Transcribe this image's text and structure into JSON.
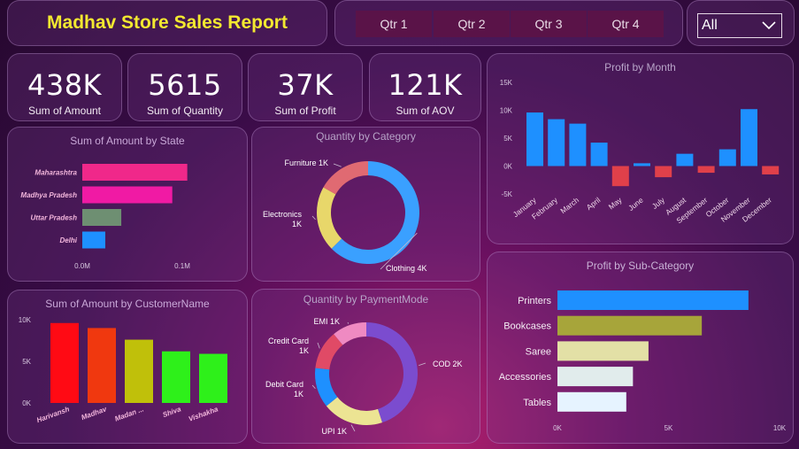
{
  "header": {
    "title": "Madhav Store Sales Report"
  },
  "quarters": [
    "Qtr 1",
    "Qtr 2",
    "Qtr 3",
    "Qtr 4"
  ],
  "filter": {
    "selected": "All"
  },
  "kpis": [
    {
      "value": "438K",
      "label": "Sum of Amount"
    },
    {
      "value": "5615",
      "label": "Sum of Quantity"
    },
    {
      "value": "37K",
      "label": "Sum of Profit"
    },
    {
      "value": "121K",
      "label": "Sum of AOV"
    }
  ],
  "colors": {
    "title": "#f2e830",
    "accent_blue": "#1e90ff",
    "negative": "#e0404a"
  },
  "chart_data": [
    {
      "id": "amount_by_state",
      "type": "bar",
      "orientation": "horizontal",
      "title": "Sum of Amount by State",
      "categories": [
        "Maharashtra",
        "Madhya Pradesh",
        "Uttar Pradesh",
        "Delhi"
      ],
      "values": [
        0.105,
        0.09,
        0.039,
        0.023
      ],
      "colors": [
        "#f0288a",
        "#f01aa4",
        "#6e8f72",
        "#1e90ff"
      ],
      "xticks": [
        "0.0M",
        "0.1M"
      ],
      "xlim": [
        0,
        0.1
      ]
    },
    {
      "id": "quantity_by_category",
      "type": "pie",
      "donut": true,
      "title": "Quantity by Category",
      "slices": [
        {
          "label": "Clothing 4K",
          "value": 3516,
          "color": "#3aa0ff"
        },
        {
          "label": "Electronics 1K",
          "value": 1154,
          "color": "#e8d76a"
        },
        {
          "label": "Furniture 1K",
          "value": 945,
          "color": "#e06a72"
        }
      ]
    },
    {
      "id": "profit_by_month",
      "type": "bar",
      "title": "Profit by Month",
      "categories": [
        "January",
        "February",
        "March",
        "April",
        "May",
        "June",
        "July",
        "August",
        "September",
        "October",
        "November",
        "December"
      ],
      "values": [
        9600,
        8400,
        7600,
        4200,
        -3600,
        500,
        -2000,
        2200,
        -1200,
        3000,
        10200,
        -1500
      ],
      "ylim": [
        -5000,
        15000
      ],
      "yticks": [
        "-5K",
        "0K",
        "5K",
        "10K",
        "15K"
      ],
      "positive_color": "#1e90ff",
      "negative_color": "#e0404a"
    },
    {
      "id": "amount_by_customer",
      "type": "bar",
      "title": "Sum of Amount by CustomerName",
      "categories": [
        "Harivansh",
        "Madhav",
        "Madan ...",
        "Shiva",
        "Vishakha"
      ],
      "values": [
        9600,
        9000,
        7600,
        6200,
        5900
      ],
      "colors": [
        "#ff0a14",
        "#f0380f",
        "#c0c00a",
        "#2ef01a",
        "#2ef01a"
      ],
      "ylim": [
        0,
        10000
      ],
      "yticks": [
        "0K",
        "5K",
        "10K"
      ]
    },
    {
      "id": "quantity_by_paymentmode",
      "type": "pie",
      "donut": true,
      "title": "Quantity by PaymentMode",
      "slices": [
        {
          "label": "COD 2K",
          "value": 2424,
          "color": "#7b4ccf"
        },
        {
          "label": "UPI 1K",
          "value": 1034,
          "color": "#ece493"
        },
        {
          "label": "Debit Card 1K",
          "value": 680,
          "color": "#1e90ff"
        },
        {
          "label": "Credit Card 1K",
          "value": 660,
          "color": "#e04a66"
        },
        {
          "label": "EMI 1K",
          "value": 590,
          "color": "#ef8ac2"
        }
      ]
    },
    {
      "id": "profit_by_subcategory",
      "type": "bar",
      "orientation": "horizontal",
      "title": "Profit by Sub-Category",
      "categories": [
        "Printers",
        "Bookcases",
        "Saree",
        "Accessories",
        "Tables"
      ],
      "values": [
        8600,
        6500,
        4100,
        3400,
        3100
      ],
      "colors": [
        "#1e90ff",
        "#a7a53a",
        "#e3e0a6",
        "#e1ecec",
        "#e6f3ff"
      ],
      "xlim": [
        0,
        10000
      ],
      "xticks": [
        "0K",
        "5K",
        "10K"
      ]
    }
  ]
}
